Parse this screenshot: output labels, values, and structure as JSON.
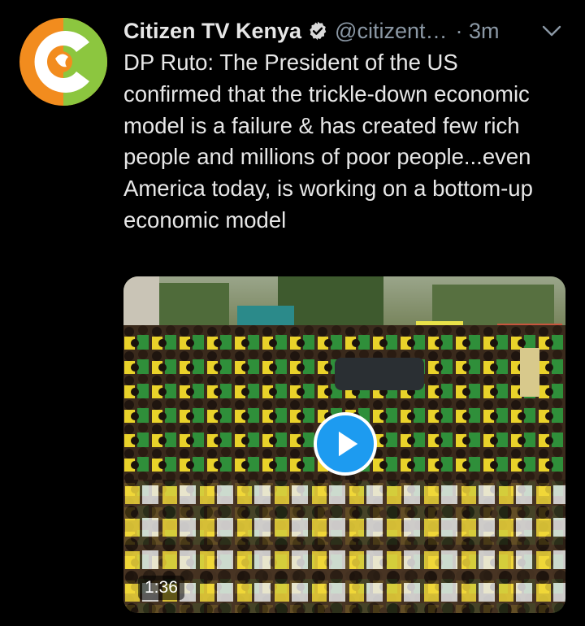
{
  "tweet": {
    "author_name": "Citizen TV Kenya",
    "handle": "@citizent…",
    "time": "· 3m",
    "text": "DP Ruto: The President of the US confirmed that the trickle-down economic model is a failure & has created few rich people and millions of poor people...even America today, is working on a bottom-up economic model",
    "video_duration": "1:36"
  },
  "icons": {
    "avatar": "citizen-tv-logo",
    "verified": "verified-badge-icon",
    "more": "chevron-down-icon",
    "play": "play-icon"
  },
  "colors": {
    "background": "#000000",
    "accent": "#1d9bf0",
    "logo_orange": "#f28c1e",
    "logo_green": "#8cc63f"
  }
}
